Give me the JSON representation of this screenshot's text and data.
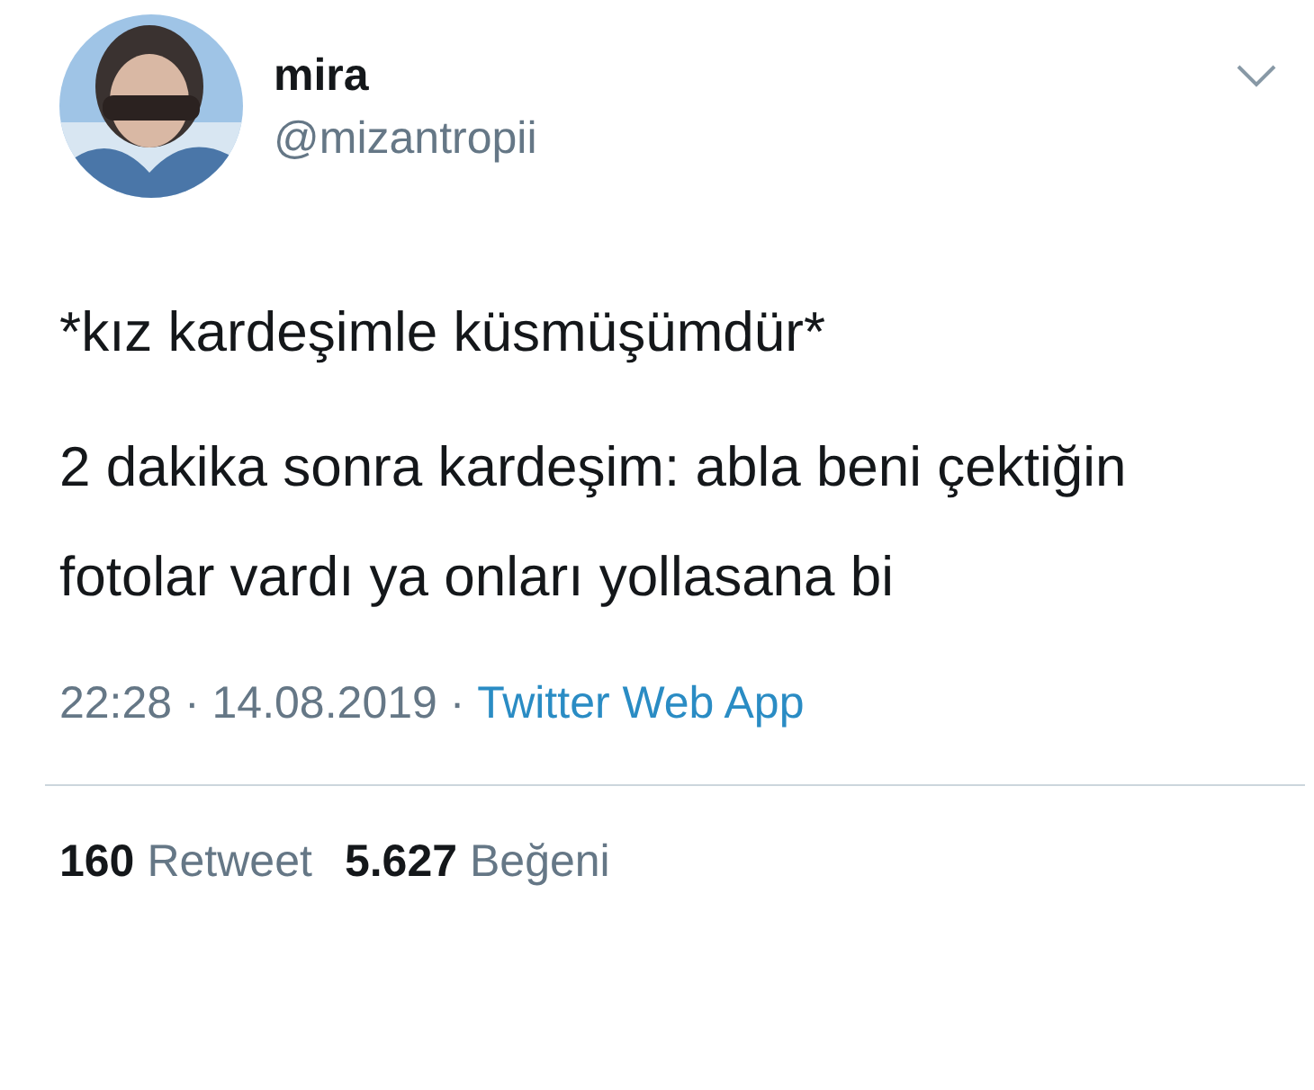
{
  "author": {
    "name": "mira",
    "handle": "@mizantropii"
  },
  "tweet": {
    "paragraphs": [
      "*kız kardeşimle küsmüşümdür*",
      "2 dakika sonra kardeşim: abla beni çektiğin fotolar vardı ya onları yollasana bi"
    ]
  },
  "meta": {
    "timestamp": "22:28 · 14.08.2019 ·",
    "source": "Twitter Web App"
  },
  "stats": [
    {
      "count": "160",
      "label": "Retweet"
    },
    {
      "count": "5.627",
      "label": "Beğeni"
    }
  ]
}
